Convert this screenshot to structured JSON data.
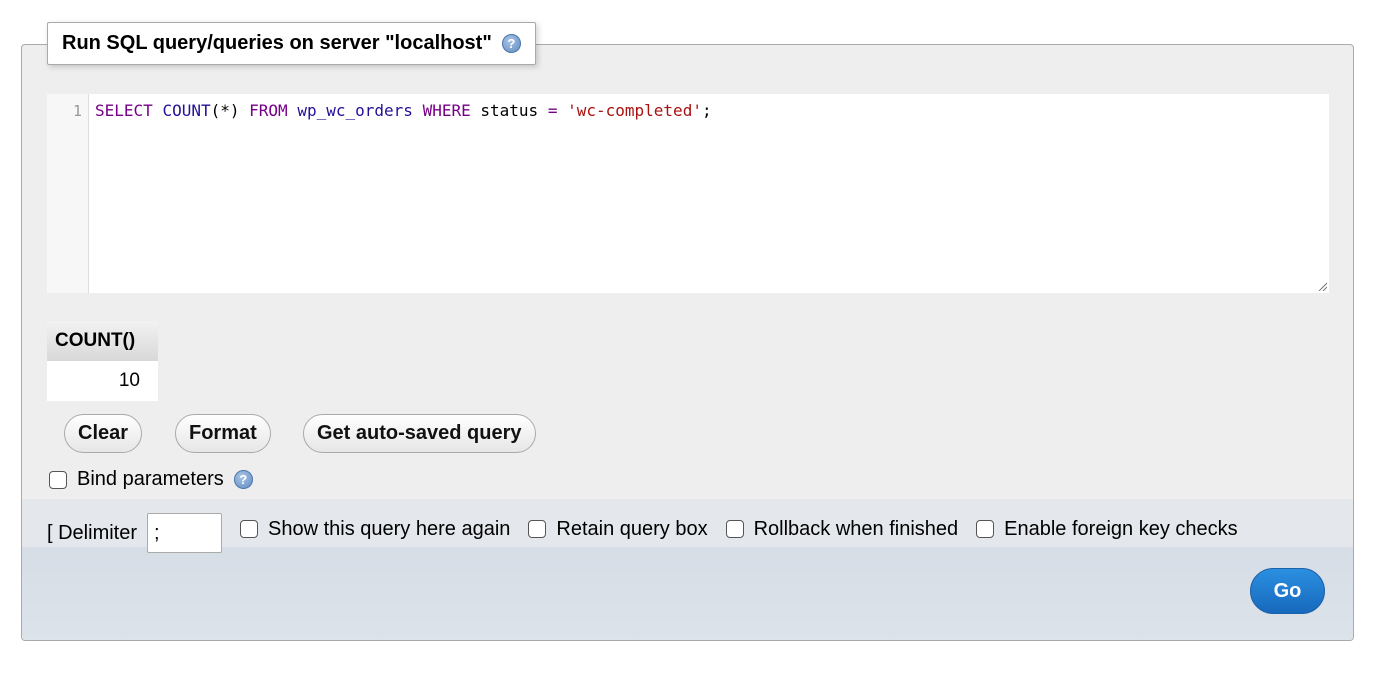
{
  "legend": {
    "title": "Run SQL query/queries on server \"localhost\"",
    "help_icon": "help-icon"
  },
  "editor": {
    "line_number": "1",
    "tokens": {
      "select": "SELECT",
      "count": "COUNT",
      "args": "(*)",
      "from": "FROM",
      "table": "wp_wc_orders",
      "where": "WHERE",
      "column": "status",
      "op": "=",
      "value": "'wc-completed'",
      "end": ";"
    }
  },
  "result": {
    "header": "COUNT()",
    "value": "10"
  },
  "buttons": {
    "clear": "Clear",
    "format": "Format",
    "autosaved": "Get auto-saved query",
    "go": "Go"
  },
  "bind_parameters": {
    "label": "Bind parameters",
    "checked": false
  },
  "options": {
    "delimiter_label": "[ Delimiter",
    "delimiter_value": ";",
    "show_again": "Show this query here again",
    "retain_box": "Retain query box",
    "rollback": "Rollback when finished",
    "foreign_keys": "Enable foreign key checks"
  },
  "colors": {
    "keyword": "#770088",
    "identifier": "#221199",
    "string": "#aa1111",
    "go_button": "#1769bd"
  }
}
